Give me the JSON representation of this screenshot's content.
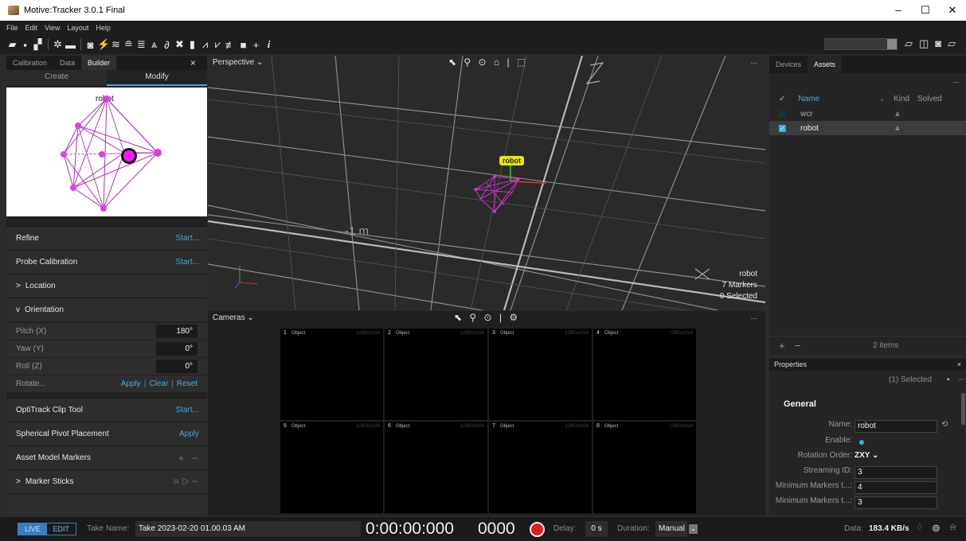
{
  "window": {
    "title": "Motive:Tracker 3.0.1 Final",
    "controls": [
      "–",
      "☐",
      "✕"
    ]
  },
  "menu": [
    "File",
    "Edit",
    "View",
    "Layout",
    "Help"
  ],
  "left_panel": {
    "tabs": [
      "Calibration",
      "Data",
      "Builder"
    ],
    "active_tab": "Builder",
    "close": "×",
    "mode_tabs": [
      "Create",
      "Modify"
    ],
    "active_mode": "Modify",
    "preview_label": "robot",
    "refine": {
      "label": "Refine",
      "action": "Start..."
    },
    "probe": {
      "label": "Probe Calibration",
      "action": "Start..."
    },
    "location": {
      "label": "Location",
      "chevron": ">"
    },
    "orientation": {
      "label": "Orientation",
      "chevron": "v"
    },
    "pitch": {
      "label": "Pitch (X)",
      "value": "180°"
    },
    "yaw": {
      "label": "Yaw (Y)",
      "value": "0°"
    },
    "roll": {
      "label": "Roll (Z)",
      "value": "0°"
    },
    "rotate": {
      "label": "Rotate...",
      "apply": "Apply",
      "clear": "Clear",
      "reset": "Reset"
    },
    "clip_tool": {
      "label": "OptiTrack Clip Tool",
      "action": "Start..."
    },
    "pivot": {
      "label": "Spherical Pivot Placement",
      "action": "Apply"
    },
    "asset_markers": {
      "label": "Asset Model Markers",
      "add": "+",
      "remove": "−"
    },
    "marker_sticks": {
      "label": "Marker Sticks",
      "chevron": ">"
    }
  },
  "perspective": {
    "title": "Perspective",
    "dots": "...",
    "axis_z": "Z",
    "axis_x": "X",
    "grid_label": "-1 m",
    "rigid_body_label": "robot",
    "stats": {
      "name": "robot",
      "markers": "7 Markers",
      "selected": "0 Selected"
    }
  },
  "cameras": {
    "title": "Cameras",
    "dots": "...",
    "tiles": [
      {
        "num": "1",
        "type": "Object",
        "res": "1280x1024"
      },
      {
        "num": "2",
        "type": "Object",
        "res": "1280x1024"
      },
      {
        "num": "3",
        "type": "Object",
        "res": "1280x1024"
      },
      {
        "num": "4",
        "type": "Object",
        "res": "1280x1024"
      },
      {
        "num": "5",
        "type": "Object",
        "res": "1280x1024"
      },
      {
        "num": "6",
        "type": "Object",
        "res": "1280x1024"
      },
      {
        "num": "7",
        "type": "Object",
        "res": "1280x1024"
      },
      {
        "num": "8",
        "type": "Object",
        "res": "1280x1024"
      }
    ]
  },
  "assets_panel": {
    "tabs": [
      "Devices",
      "Assets"
    ],
    "active_tab": "Assets",
    "dots": "...",
    "columns": {
      "name": "Name",
      "kind": "Kind",
      "solved": "Solved"
    },
    "rows": [
      {
        "name": "wcr",
        "checked": false
      },
      {
        "name": "robot",
        "checked": true
      }
    ],
    "footer": {
      "add": "+",
      "remove": "−",
      "count": "2 items"
    }
  },
  "properties": {
    "title": "Properties",
    "selected": "(1) Selected",
    "section": "General",
    "name": {
      "label": "Name:",
      "value": "robot"
    },
    "enable": {
      "label": "Enable:"
    },
    "rotation_order": {
      "label": "Rotation Order:",
      "value": "ZXY"
    },
    "streaming_id": {
      "label": "Streaming ID:",
      "value": "3"
    },
    "min_markers_1": {
      "label": "Minimum Markers t...:",
      "value": "4"
    },
    "min_markers_2": {
      "label": "Minimum Markers t...:",
      "value": "3"
    }
  },
  "bottom": {
    "live": "LIVE",
    "edit": "EDIT",
    "take_label": "Take Name:",
    "take_value": "Take 2023-02-20 01.00.03 AM",
    "timecode": "0:00:00:000",
    "frame": "0000",
    "delay_label": "Delay:",
    "delay_value": "0 s",
    "duration_label": "Duration:",
    "duration_value": "Manual",
    "data_label": "Data:",
    "data_value": "183.4 KB/s"
  },
  "colors": {
    "accent": "#4aa8d8",
    "marker": "#c832c8",
    "record": "#e01e1e",
    "label_bg": "#e8e800"
  }
}
